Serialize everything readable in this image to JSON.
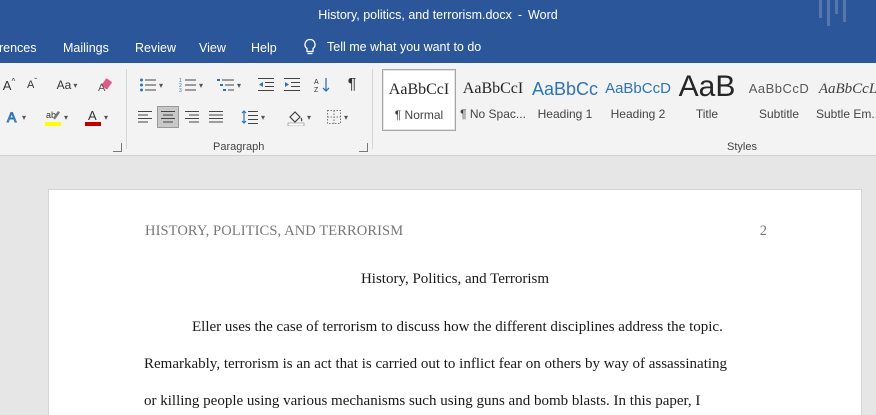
{
  "window": {
    "doc_name": "History, politics, and terrorism.docx",
    "separator": "-",
    "app_name": "Word"
  },
  "menu": {
    "items": [
      "erences",
      "Mailings",
      "Review",
      "View",
      "Help"
    ],
    "tell_me": "Tell me what you want to do"
  },
  "ribbon": {
    "font_group": {
      "change_case_label": "Aa",
      "grow_font_label": "A",
      "shrink_font_label": "A"
    },
    "paragraph_group": {
      "label": "Paragraph",
      "show_marks_symbol": "¶"
    },
    "styles_group": {
      "label": "Styles",
      "styles": [
        {
          "preview": "AaBbCcI",
          "name": "¶ Normal",
          "color": "#000000"
        },
        {
          "preview": "AaBbCcI",
          "name": "¶ No Spac...",
          "color": "#000000"
        },
        {
          "preview": "AaBbCc",
          "name": "Heading 1",
          "color": "#2e74b5"
        },
        {
          "preview": "AaBbCcD",
          "name": "Heading 2",
          "color": "#2e74b5"
        },
        {
          "preview": "AaB",
          "name": "Title",
          "color": "#000000"
        },
        {
          "preview": "AaBbCcD",
          "name": "Subtitle",
          "color": "#595959"
        },
        {
          "preview": "AaBbCcL",
          "name": "Subtle Em...",
          "color": "#404040"
        }
      ]
    }
  },
  "colors": {
    "title_bar": "#2b579a",
    "highlight": "#ffff00",
    "font_color": "#c00000"
  },
  "document": {
    "running_head": "HISTORY, POLITICS, AND TERRORISM",
    "page_number": "2",
    "title": "History, Politics, and Terrorism",
    "paragraph_lines": [
      "Eller uses the case of terrorism to discuss how the different disciplines address the topic.",
      "Remarkably, terrorism is an act that is carried out to inflict fear on others by way of assassinating",
      "or killing people using various mechanisms such using guns and bomb blasts. In this paper, I"
    ]
  }
}
